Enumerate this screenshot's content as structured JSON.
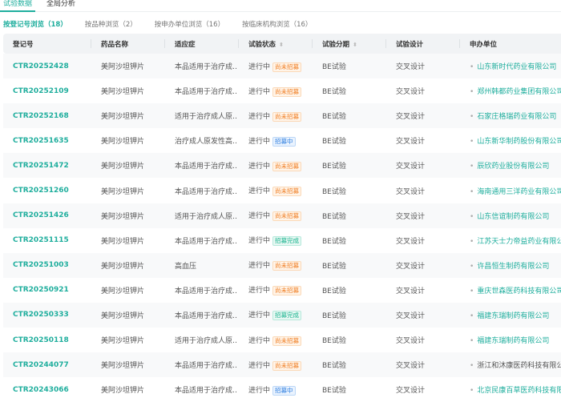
{
  "top_tabs": [
    {
      "label": "试验数据",
      "active": true
    },
    {
      "label": "全局分析",
      "active": false
    }
  ],
  "sub_tabs": [
    {
      "label": "按登记号浏览（18）",
      "active": true
    },
    {
      "label": "按品种浏览（2）"
    },
    {
      "label": "按申办单位浏览（16）"
    },
    {
      "label": "按临床机构浏览（16）"
    }
  ],
  "columns": [
    "登记号",
    "药品名称",
    "适应症",
    "试验状态",
    "试验分期",
    "试验设计",
    "申办单位"
  ],
  "sortable": [
    "试验状态",
    "试验分期"
  ],
  "colors": {
    "accent": "#1fae9d",
    "pending": "#f07d22",
    "done": "#19b38e",
    "recruiting": "#2f7fe0"
  },
  "rows": [
    {
      "id": "CTR20252428",
      "drug": "美阿沙坦钾片",
      "ind": "本品适用于治疗成…",
      "status": "进行中",
      "badge": "尚未招募",
      "bt": "orange",
      "phase": "BE试验",
      "design": "交叉设计",
      "sponsor": "山东新时代药业有限公司",
      "link": true
    },
    {
      "id": "CTR20252109",
      "drug": "美阿沙坦钾片",
      "ind": "本品适用于治疗成…",
      "status": "进行中",
      "badge": "尚未招募",
      "bt": "orange",
      "phase": "BE试验",
      "design": "交叉设计",
      "sponsor": "郑州韩都药业集团有限公司",
      "link": true
    },
    {
      "id": "CTR20252168",
      "drug": "美阿沙坦钾片",
      "ind": "适用于治疗成人原…",
      "status": "进行中",
      "badge": "尚未招募",
      "bt": "orange",
      "phase": "BE试验",
      "design": "交叉设计",
      "sponsor": "石家庄格瑞药业有限公司",
      "link": true
    },
    {
      "id": "CTR20251635",
      "drug": "美阿沙坦钾片",
      "ind": "治疗成人原发性高…",
      "status": "进行中",
      "badge": "招募中",
      "bt": "blue",
      "phase": "BE试验",
      "design": "交叉设计",
      "sponsor": "山东新华制药股份有限公司",
      "link": true
    },
    {
      "id": "CTR20251472",
      "drug": "美阿沙坦钾片",
      "ind": "本品适用于治疗成…",
      "status": "进行中",
      "badge": "尚未招募",
      "bt": "orange",
      "phase": "BE试验",
      "design": "交叉设计",
      "sponsor": "辰欣药业股份有限公司",
      "link": true
    },
    {
      "id": "CTR20251260",
      "drug": "美阿沙坦钾片",
      "ind": "本品适用于治疗成…",
      "status": "进行中",
      "badge": "尚未招募",
      "bt": "orange",
      "phase": "BE试验",
      "design": "交叉设计",
      "sponsor": "海南通用三洋药业有限公司",
      "link": true
    },
    {
      "id": "CTR20251426",
      "drug": "美阿沙坦钾片",
      "ind": "适用于治疗成人原…",
      "status": "进行中",
      "badge": "尚未招募",
      "bt": "orange",
      "phase": "BE试验",
      "design": "交叉设计",
      "sponsor": "山东信谊制药有限公司",
      "link": true
    },
    {
      "id": "CTR20251115",
      "drug": "美阿沙坦钾片",
      "ind": "本品适用于治疗成…",
      "status": "进行中",
      "badge": "招募完成",
      "bt": "green",
      "phase": "BE试验",
      "design": "交叉设计",
      "sponsor": "江苏天士力帝益药业有限公司",
      "link": true
    },
    {
      "id": "CTR20251003",
      "drug": "美阿沙坦钾片",
      "ind": "高血压",
      "status": "进行中",
      "badge": "尚未招募",
      "bt": "orange",
      "phase": "BE试验",
      "design": "交叉设计",
      "sponsor": "许昌恒生制药有限公司",
      "link": true
    },
    {
      "id": "CTR20250921",
      "drug": "美阿沙坦钾片",
      "ind": "本品适用于治疗成…",
      "status": "进行中",
      "badge": "尚未招募",
      "bt": "orange",
      "phase": "BE试验",
      "design": "交叉设计",
      "sponsor": "重庆世森医药科技有限公司",
      "link": true
    },
    {
      "id": "CTR20250333",
      "drug": "美阿沙坦钾片",
      "ind": "本品适用于治疗成…",
      "status": "进行中",
      "badge": "招募完成",
      "bt": "green",
      "phase": "BE试验",
      "design": "交叉设计",
      "sponsor": "福建东瑞制药有限公司",
      "link": true
    },
    {
      "id": "CTR20250118",
      "drug": "美阿沙坦钾片",
      "ind": "适用于治疗成人原…",
      "status": "进行中",
      "badge": "尚未招募",
      "bt": "orange",
      "phase": "BE试验",
      "design": "交叉设计",
      "sponsor": "福建东瑞制药有限公司",
      "link": true
    },
    {
      "id": "CTR20244077",
      "drug": "美阿沙坦钾片",
      "ind": "本品适用于治疗成…",
      "status": "进行中",
      "badge": "尚未招募",
      "bt": "orange",
      "phase": "BE试验",
      "design": "交叉设计",
      "sponsor": "浙江和沐康医药科技有限公司",
      "link": false
    },
    {
      "id": "CTR20243066",
      "drug": "美阿沙坦钾片",
      "ind": "本品适用于治疗成…",
      "status": "进行中",
      "badge": "招募中",
      "bt": "blue",
      "phase": "BE试验",
      "design": "交叉设计",
      "sponsor": "北京民康百草医药科技有限…",
      "link": true
    }
  ]
}
